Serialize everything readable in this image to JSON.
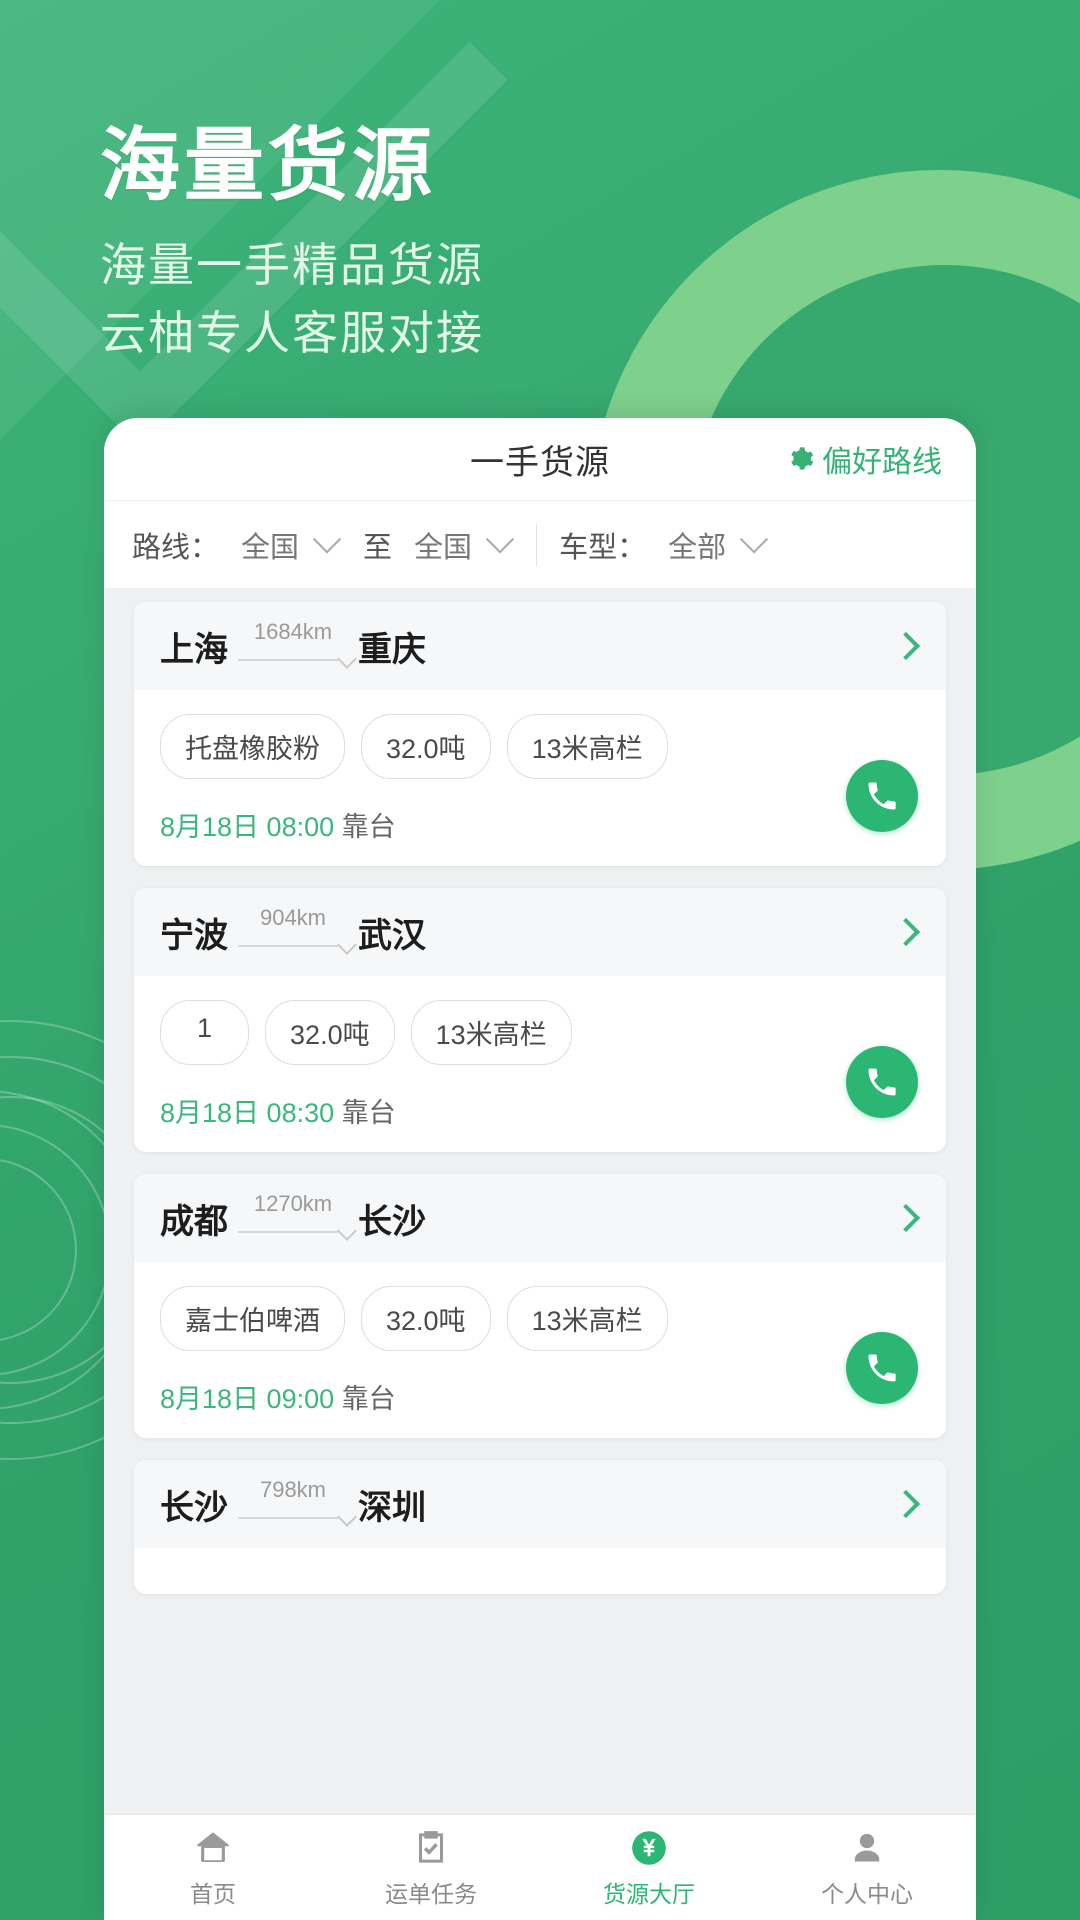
{
  "promo": {
    "title": "海量货源",
    "subtitle_line1": "海量一手精品货源",
    "subtitle_line2": "云柚专人客服对接"
  },
  "colors": {
    "brand_green": "#2bb673",
    "header_green": "#36b276",
    "bg_green": "#36a96f",
    "accent_light": "#7ed08d"
  },
  "app": {
    "header": {
      "title": "一手货源",
      "pref_label": "偏好路线",
      "pref_icon": "gear-icon"
    },
    "filter": {
      "route_label": "路线：",
      "origin": "全国",
      "to_label": "至",
      "destination": "全国",
      "vehicle_label": "车型：",
      "vehicle": "全部"
    },
    "cards": [
      {
        "origin": "上海",
        "distance": "1684km",
        "destination": "重庆",
        "tags": [
          "托盘橡胶粉",
          "32.0吨",
          "13米高栏"
        ],
        "time": "8月18日 08:00",
        "time_suffix": "靠台",
        "call_icon": "phone-icon",
        "chevron": "chevron-right-icon"
      },
      {
        "origin": "宁波",
        "distance": "904km",
        "destination": "武汉",
        "tags": [
          "1",
          "32.0吨",
          "13米高栏"
        ],
        "time": "8月18日 08:30",
        "time_suffix": "靠台",
        "call_icon": "phone-icon",
        "chevron": "chevron-right-icon"
      },
      {
        "origin": "成都",
        "distance": "1270km",
        "destination": "长沙",
        "tags": [
          "嘉士伯啤酒",
          "32.0吨",
          "13米高栏"
        ],
        "time": "8月18日 09:00",
        "time_suffix": "靠台",
        "call_icon": "phone-icon",
        "chevron": "chevron-right-icon"
      },
      {
        "origin": "长沙",
        "distance": "798km",
        "destination": "深圳",
        "tags": [],
        "time": "",
        "time_suffix": "",
        "call_icon": "phone-icon",
        "chevron": "chevron-right-icon"
      }
    ],
    "tabbar": [
      {
        "label": "首页",
        "icon": "home-icon",
        "active": false
      },
      {
        "label": "运单任务",
        "icon": "clipboard-check-icon",
        "active": false
      },
      {
        "label": "货源大厅",
        "icon": "yuan-badge-icon",
        "active": true
      },
      {
        "label": "个人中心",
        "icon": "person-icon",
        "active": false
      }
    ]
  }
}
